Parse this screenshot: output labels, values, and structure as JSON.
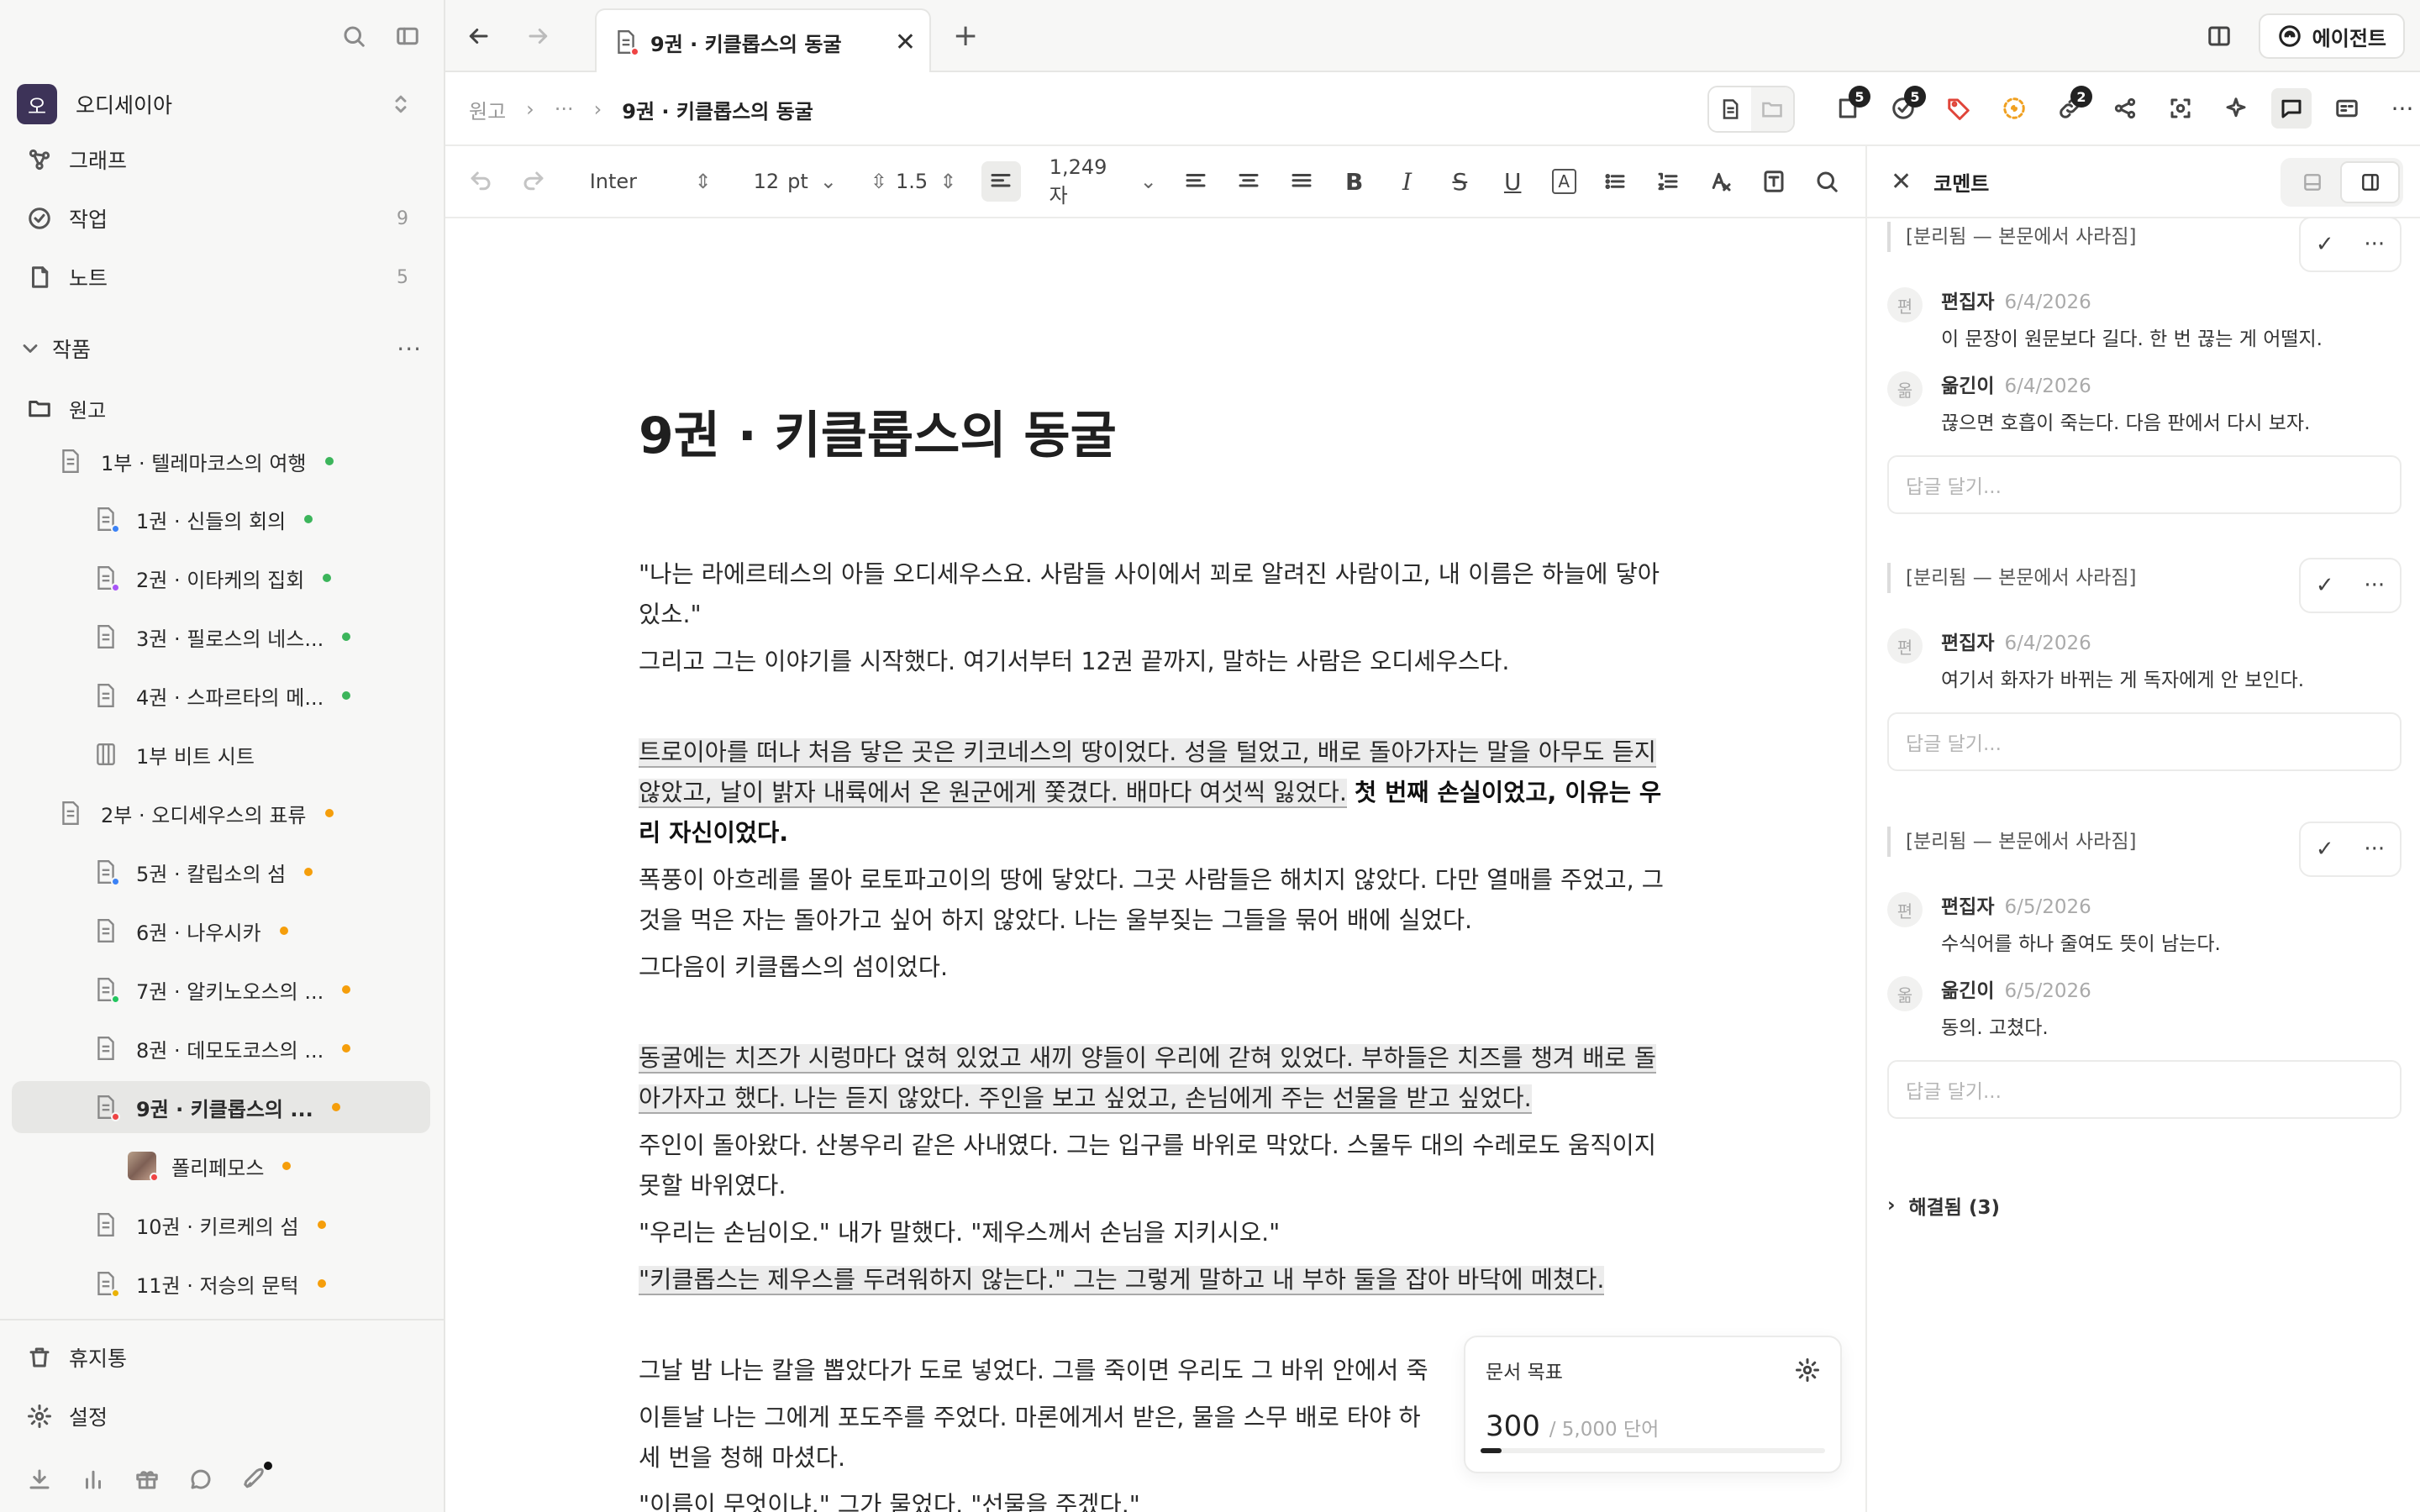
{
  "sidebar": {
    "workspace": {
      "initial": "오",
      "name": "오디세이아"
    },
    "nav": [
      {
        "label": "그래프",
        "count": ""
      },
      {
        "label": "작업",
        "count": "9"
      },
      {
        "label": "노트",
        "count": "5"
      }
    ],
    "section_title": "작품",
    "root_folder": "원고",
    "tree": [
      {
        "label": "1부 · 텔레마코스의 여행",
        "dot": "#3cb55b",
        "badge": ""
      },
      {
        "label": "1권 · 신들의 회의",
        "dot": "#3cb55b",
        "badge": "#3b82f6"
      },
      {
        "label": "2권 · 이타케의 집회",
        "dot": "#3cb55b",
        "badge": "#a855f7"
      },
      {
        "label": "3권 · 필로스의 네스...",
        "dot": "#3cb55b",
        "badge": ""
      },
      {
        "label": "4권 · 스파르타의 메...",
        "dot": "#3cb55b",
        "badge": ""
      },
      {
        "label": "1부 비트 시트",
        "dot": "",
        "badge": ""
      },
      {
        "label": "2부 · 오디세우스의 표류",
        "dot": "#f59e0b",
        "badge": ""
      },
      {
        "label": "5권 · 칼립소의 섬",
        "dot": "#f59e0b",
        "badge": "#3b82f6"
      },
      {
        "label": "6권 · 나우시카",
        "dot": "#f59e0b",
        "badge": ""
      },
      {
        "label": "7권 · 알키노오스의 ...",
        "dot": "#f59e0b",
        "badge": "#22c55e"
      },
      {
        "label": "8권 · 데모도코스의 ...",
        "dot": "#f59e0b",
        "badge": ""
      },
      {
        "label": "9권 · 키클롭스의 ...",
        "dot": "#f59e0b",
        "badge": "#ef4444"
      },
      {
        "label": "폴리페모스",
        "dot": "#f59e0b",
        "badge": "#ef4444"
      },
      {
        "label": "10권 · 키르케의 섬",
        "dot": "#f59e0b",
        "badge": ""
      },
      {
        "label": "11권 · 저승의 문턱",
        "dot": "#f59e0b",
        "badge": "#eab308"
      }
    ],
    "bottom": {
      "trash": "휴지통",
      "settings": "설정"
    }
  },
  "tabbar": {
    "tab_title": "9권 · 키클롭스의 동굴",
    "agent_label": "에이전트"
  },
  "header": {
    "breadcrumb": [
      "원고",
      "···",
      "9권 · 키클롭스의 동굴"
    ],
    "badges": {
      "files": "5",
      "tasks": "5",
      "links": "2"
    }
  },
  "toolbar": {
    "font": "Inter",
    "size": "12",
    "unit": "pt",
    "line_height": "1.5",
    "char_count": "1,249 자"
  },
  "document": {
    "title": "9권 · 키클롭스의 동굴",
    "p1": "\"나는 라에르테스의 아들 오디세우스요. 사람들 사이에서 꾀로 알려진 사람이고, 내 이름은 하늘에 닿아 있소.\"",
    "p2": "그리고 그는 이야기를 시작했다. 여기서부터 12권 끝까지, 말하는 사람은 오디세우스다.",
    "p3a": "트로이아를 떠나 처음 닿은 곳은 키코네스의 땅이었다. 성을 털었고, 배로 돌아가자는 말을 아무도 듣지 않았고, 날이 밝자 내륙에서 온 원군에게 쫓겼다. 배마다 여섯씩 잃었다.",
    "p3b": "첫 번째 손실이었고, 이유는 우리 자신이었다.",
    "p4": "폭풍이 아흐레를 몰아 로토파고이의 땅에 닿았다. 그곳 사람들은 해치지 않았다. 다만 열매를 주었고, 그것을 먹은 자는 돌아가고 싶어 하지 않았다. 나는 울부짖는 그들을 묶어 배에 실었다.",
    "p5": "그다음이 키클롭스의 섬이었다.",
    "p6": "동굴에는 치즈가 시렁마다 얹혀 있었고 새끼 양들이 우리에 갇혀 있었다. 부하들은 치즈를 챙겨 배로 돌아가자고 했다. 나는 듣지 않았다. 주인을 보고 싶었고, 손님에게 주는 선물을 받고 싶었다.",
    "p7": "주인이 돌아왔다. 산봉우리 같은 사내였다. 그는 입구를 바위로 막았다. 스물두 대의 수레로도 움직이지 못할 바위였다.",
    "p8": "\"우리는 손님이오.\" 내가 말했다. \"제우스께서 손님을 지키시오.\"",
    "p9": "\"키클롭스는 제우스를 두려워하지 않는다.\" 그는 그렇게 말하고 내 부하 둘을 잡아 바닥에 메쳤다.",
    "p10": "그날 밤 나는 칼을 뽑았다가 도로 넣었다. 그를 죽이면 우리도 그 바위 안에서 죽",
    "p11": "이튿날 나는 그에게 포도주를 주었다. 마론에게서 받은, 물을 스무 배로 타야 하",
    "p12": "세 번을 청해 마셨다.",
    "p13": "\"이름이 무엇이냐.\" 그가 물었다. \"선물을 주겠다.\""
  },
  "goal": {
    "title": "문서 목표",
    "value": "300",
    "target": "/ 5,000 단어",
    "progress": 0.06
  },
  "comments": {
    "title": "코멘트",
    "threads": [
      {
        "ref": "[분리됨 — 본문에서 사라짐]",
        "items": [
          {
            "avatar": "편",
            "author": "편집자",
            "date": "6/4/2026",
            "text": "이 문장이 원문보다 길다. 한 번 끊는 게 어떨지."
          },
          {
            "avatar": "옮",
            "author": "옮긴이",
            "date": "6/4/2026",
            "text": "끊으면 호흡이 죽는다. 다음 판에서 다시 보자."
          }
        ],
        "reply_placeholder": "답글 달기..."
      },
      {
        "ref": "[분리됨 — 본문에서 사라짐]",
        "items": [
          {
            "avatar": "편",
            "author": "편집자",
            "date": "6/4/2026",
            "text": "여기서 화자가 바뀌는 게 독자에게 안 보인다."
          }
        ],
        "reply_placeholder": "답글 달기..."
      },
      {
        "ref": "[분리됨 — 본문에서 사라짐]",
        "items": [
          {
            "avatar": "편",
            "author": "편집자",
            "date": "6/5/2026",
            "text": "수식어를 하나 줄여도 뜻이 남는다."
          },
          {
            "avatar": "옮",
            "author": "옮긴이",
            "date": "6/5/2026",
            "text": "동의. 고쳤다."
          }
        ],
        "reply_placeholder": "답글 달기..."
      }
    ],
    "resolved_label": "해결됨 (3)"
  }
}
